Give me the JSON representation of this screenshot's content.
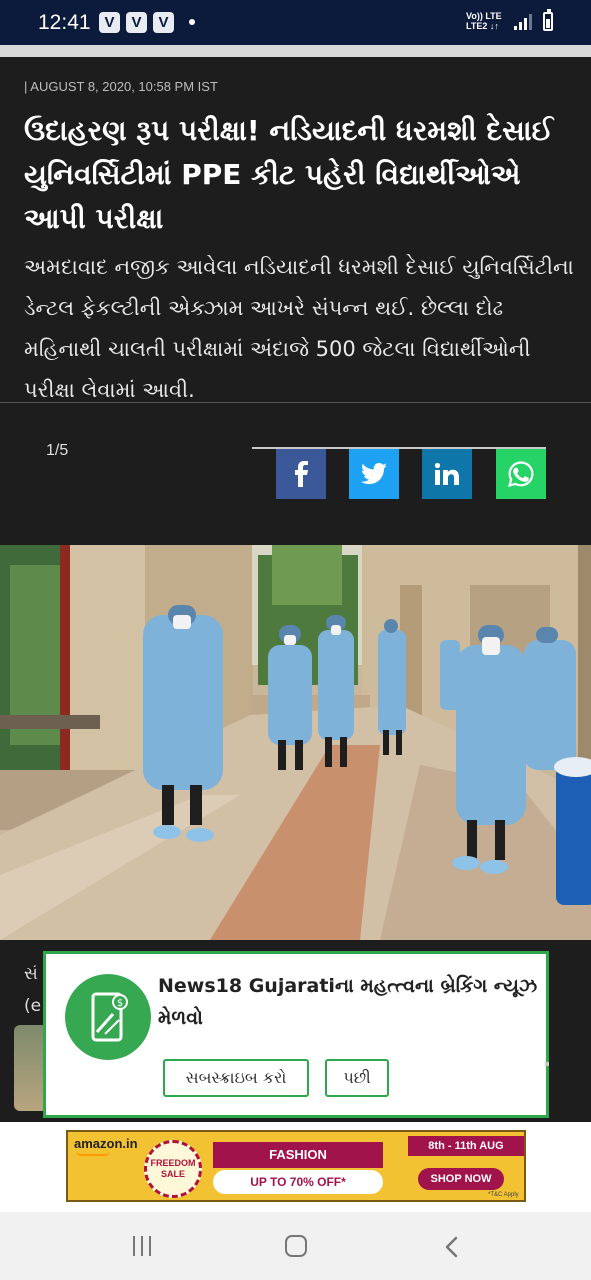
{
  "status_bar": {
    "time": "12:41",
    "notification_badges": [
      "V",
      "V",
      "V"
    ],
    "network_line1": "Vo))  LTE",
    "network_line2": "LTE2 ↓↑",
    "icons": [
      "signal-icon",
      "battery-icon"
    ]
  },
  "article": {
    "dateline": "| AUGUST 8, 2020, 10:58 PM IST",
    "headline": "ઉદાહરણ રૂપ પરીક્ષા! નડિયાદની ધરમશી દેસાઈ યુનિવર્સિટીમાં PPE કીટ પહેરી વિદ્યાર્થીઓએ આપી પરીક્ષા",
    "summary": "અમદાવાદ નજીક આવેલા નડિયાદની ધરમશી દેસાઈ યુનિવર્સિટીના ડેન્ટલ ફેકલ્ટીની એક્ઝામ આખરે સંપન્ન થઈ. છેલ્લા દોઢ મહિનાથી ચાલતી પરીક્ષામાં અંદાજે 500 જેટલા વિદ્યાર્થીઓની પરીક્ષા લેવામાં આવી.",
    "gallery_counter": "1/5",
    "share_buttons": [
      {
        "name": "facebook",
        "icon": "facebook-icon",
        "color": "#3b5998"
      },
      {
        "name": "twitter",
        "icon": "twitter-icon",
        "color": "#1da1f2"
      },
      {
        "name": "linkedin",
        "icon": "linkedin-icon",
        "color": "#0e76a8"
      },
      {
        "name": "whatsapp",
        "icon": "whatsapp-icon",
        "color": "#25d366"
      }
    ],
    "caption_fragment_1": "સં",
    "caption_fragment_2": "(e"
  },
  "popup": {
    "title": "News18 Gujaratiના મહત્ત્વના બ્રેકિંગ ન્યૂઝ મેળવો",
    "subscribe_label": "સબસ્ક્રાઇબ કરો",
    "later_label": "પછી",
    "icon": "mobile-notification-icon",
    "accent": "#2ea84a"
  },
  "ad": {
    "brand": "amazon.in",
    "seal_text": "FREEDOM SALE",
    "headline": "FASHION",
    "offer": "UP TO 70% OFF*",
    "dates": "8th - 11th AUG",
    "cta": "SHOP NOW",
    "terms": "*T&C Apply"
  },
  "nav_bar": {
    "icons": [
      "recents-icon",
      "home-icon",
      "back-icon"
    ]
  }
}
